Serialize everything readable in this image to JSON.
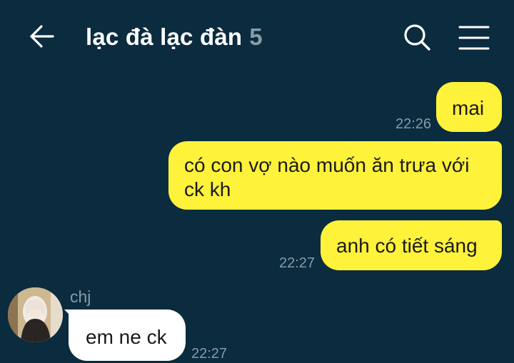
{
  "header": {
    "title": "lạc đà lạc đàn",
    "member_count": "5",
    "back_icon": "arrow-left-icon",
    "search_icon": "search-icon",
    "menu_icon": "menu-icon"
  },
  "messages": [
    {
      "direction": "outgoing",
      "text": "mai",
      "time": "22:26"
    },
    {
      "direction": "outgoing",
      "text": "có con vợ nào muốn ăn trưa với ck kh",
      "time": ""
    },
    {
      "direction": "outgoing",
      "text": "anh có tiết sáng",
      "time": "22:27"
    },
    {
      "direction": "incoming",
      "sender": "chj",
      "text": "em ne ck",
      "time": "22:27"
    }
  ],
  "colors": {
    "background": "#0b2b3f",
    "outgoing_bubble": "#fff23b",
    "incoming_bubble": "#ffffff",
    "muted_text": "#8a9aa6"
  }
}
